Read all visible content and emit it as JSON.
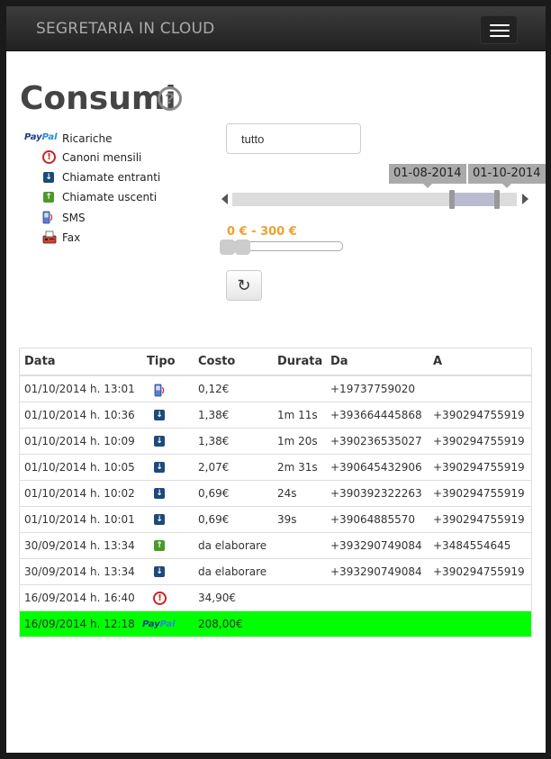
{
  "app": {
    "brand": "SEGRETARIA IN CLOUD"
  },
  "page": {
    "title": "Consumi",
    "help_glyph": "?"
  },
  "legend": [
    {
      "icon": "paypal-icon",
      "label": "Ricariche"
    },
    {
      "icon": "exclamation-icon",
      "label": "Canoni mensili"
    },
    {
      "icon": "arrow-down-icon",
      "label": "Chiamate entranti"
    },
    {
      "icon": "arrow-up-icon",
      "label": "Chiamate uscenti"
    },
    {
      "icon": "sms-icon",
      "label": "SMS"
    },
    {
      "icon": "fax-icon",
      "label": "Fax"
    }
  ],
  "paypal": {
    "part1": "Pay",
    "part2": "Pal"
  },
  "filters": {
    "type_value": "tutto",
    "date_from": "01-08-2014",
    "date_to": "01-10-2014",
    "cost_range_label": "0 € - 300 €",
    "refresh_glyph": "↻"
  },
  "table": {
    "headers": {
      "data": "Data",
      "tipo": "Tipo",
      "costo": "Costo",
      "durata": "Durata",
      "da": "Da",
      "a": "A"
    },
    "rows": [
      {
        "data": "01/10/2014 h. 13:01",
        "tipo": "sms",
        "costo": "0,12€",
        "durata": "",
        "da": "+19737759020",
        "a": ""
      },
      {
        "data": "01/10/2014 h. 10:36",
        "tipo": "in",
        "costo": "1,38€",
        "durata": "1m 11s",
        "da": "+393664445868",
        "a": "+390294755919"
      },
      {
        "data": "01/10/2014 h. 10:09",
        "tipo": "in",
        "costo": "1,38€",
        "durata": "1m 20s",
        "da": "+390236535027",
        "a": "+390294755919"
      },
      {
        "data": "01/10/2014 h. 10:05",
        "tipo": "in",
        "costo": "2,07€",
        "durata": "2m 31s",
        "da": "+390645432906",
        "a": "+390294755919"
      },
      {
        "data": "01/10/2014 h. 10:02",
        "tipo": "in",
        "costo": "0,69€",
        "durata": "24s",
        "da": "+390392322263",
        "a": "+390294755919"
      },
      {
        "data": "01/10/2014 h. 10:01",
        "tipo": "in",
        "costo": "0,69€",
        "durata": "39s",
        "da": "+39064885570",
        "a": "+390294755919"
      },
      {
        "data": "30/09/2014 h. 13:34",
        "tipo": "out",
        "costo": "da elaborare",
        "durata": "",
        "da": "+393290749084",
        "a": "+3484554645"
      },
      {
        "data": "30/09/2014 h. 13:34",
        "tipo": "in",
        "costo": "da elaborare",
        "durata": "",
        "da": "+393290749084",
        "a": "+390294755919"
      },
      {
        "data": "16/09/2014 h. 16:40",
        "tipo": "canone",
        "costo": "34,90€",
        "durata": "",
        "da": "",
        "a": ""
      },
      {
        "data": "16/09/2014 h. 12:18",
        "tipo": "paypal",
        "costo": "208,00€",
        "durata": "",
        "da": "",
        "a": "",
        "highlight": true
      }
    ]
  },
  "colors": {
    "highlight": "#00ff00",
    "cost_label": "#f0a030",
    "incoming": "#1d4a7a",
    "outgoing": "#4a9a2a",
    "alert": "#cc2222"
  }
}
